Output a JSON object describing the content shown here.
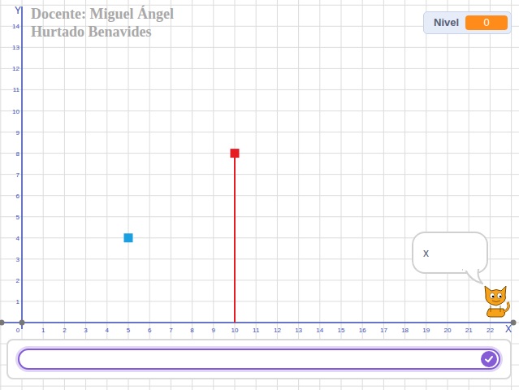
{
  "title": [
    "Docente: Miguel Ángel",
    "Hurtado Benavides"
  ],
  "monitor": {
    "label": "Nivel",
    "value": "0"
  },
  "chart": {
    "x_axis_label": "X",
    "y_axis_label": "Y",
    "x_ticks": [
      "0",
      "1",
      "2",
      "3",
      "4",
      "5",
      "6",
      "7",
      "8",
      "9",
      "10",
      "11",
      "12",
      "13",
      "14",
      "15",
      "16",
      "17",
      "18",
      "19",
      "20",
      "21",
      "22"
    ],
    "y_ticks": [
      "1",
      "2",
      "3",
      "4",
      "5",
      "6",
      "7",
      "8",
      "9",
      "10",
      "11",
      "12",
      "13",
      "14"
    ],
    "points": [
      {
        "x": 5,
        "y": 4,
        "color": "#1a9fe0",
        "drop_line": false
      },
      {
        "x": 10,
        "y": 8,
        "color": "#e61c24",
        "drop_line": true
      }
    ]
  },
  "speech_bubble": {
    "text": "x"
  },
  "answer_input": {
    "value": "",
    "focused": true
  }
}
